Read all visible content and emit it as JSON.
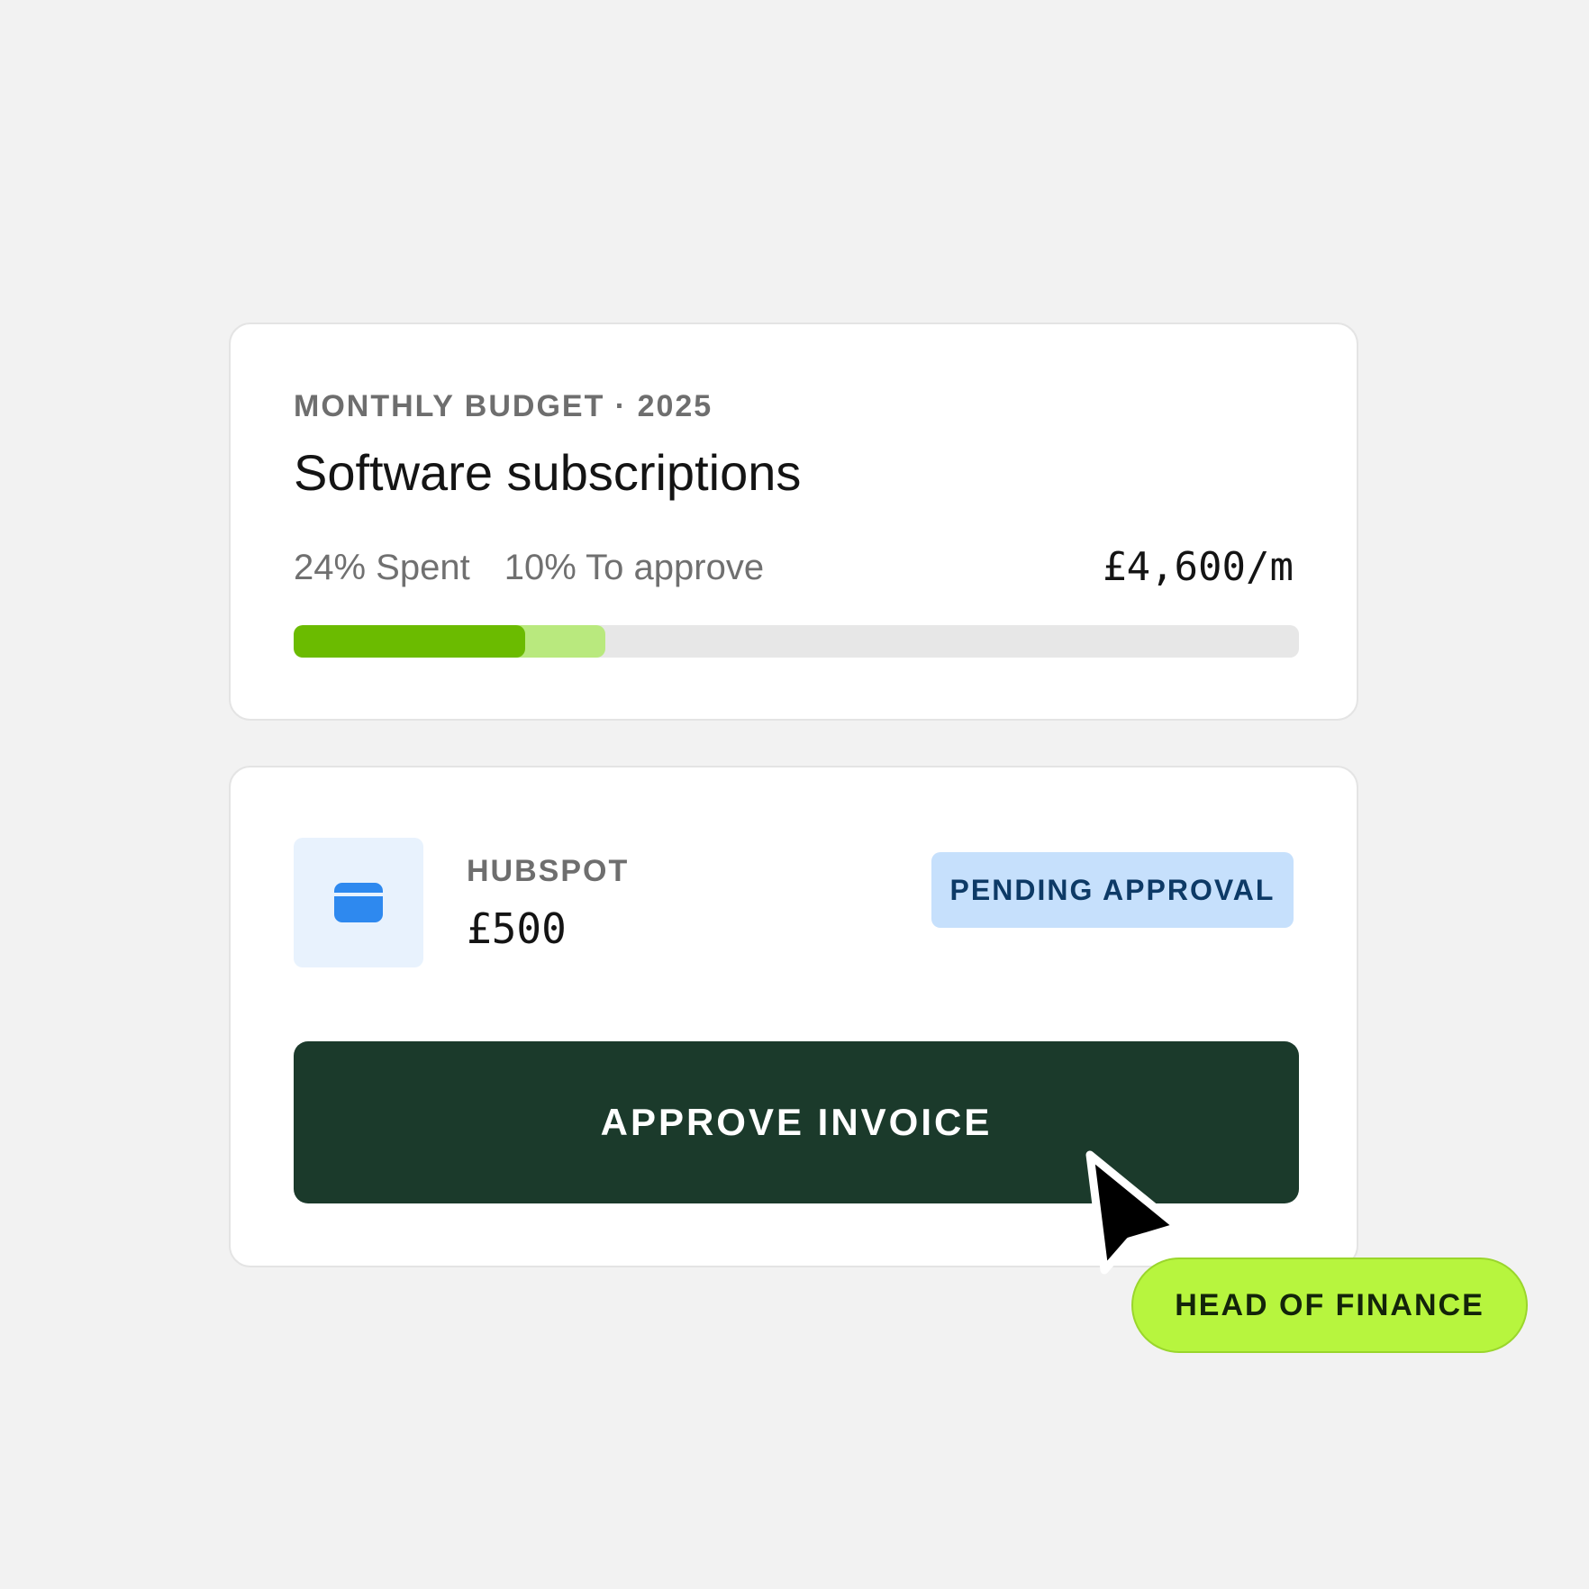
{
  "budget": {
    "eyebrow": "MONTHLY BUDGET · 2025",
    "title": "Software subscriptions",
    "spent_label": "24% Spent",
    "to_approve_label": "10% To approve",
    "amount": "£4,600/m",
    "spent_fraction": 0.23,
    "approve_fraction": 0.31,
    "colors": {
      "spent": "#6bbb00",
      "approve": "#b9e97e",
      "track": "#e7e7e7"
    }
  },
  "invoice": {
    "icon": "credit-card-icon",
    "vendor": "HUBSPOT",
    "amount": "£500",
    "status": "PENDING APPROVAL",
    "action_label": "APPROVE INVOICE",
    "colors": {
      "button": "#1b3a2b",
      "status_bg": "#c6e0fc",
      "status_text": "#0d3a66",
      "icon": "#2e89ef"
    }
  },
  "cursor_label": "HEAD OF FINANCE",
  "cursor_label_color": "#b7f53e"
}
